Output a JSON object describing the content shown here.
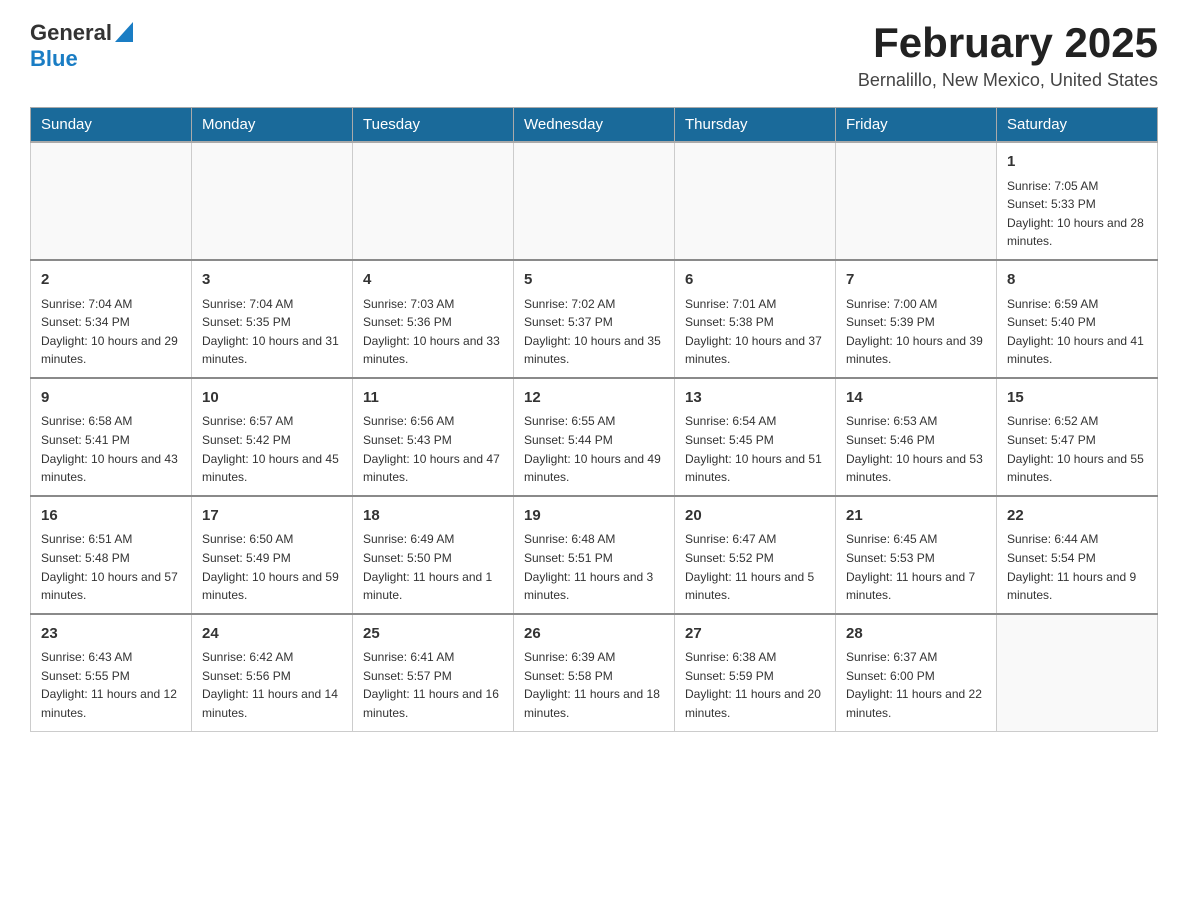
{
  "header": {
    "logo_general": "General",
    "logo_blue": "Blue",
    "month_title": "February 2025",
    "location": "Bernalillo, New Mexico, United States"
  },
  "calendar": {
    "days_of_week": [
      "Sunday",
      "Monday",
      "Tuesday",
      "Wednesday",
      "Thursday",
      "Friday",
      "Saturday"
    ],
    "weeks": [
      [
        {
          "day": "",
          "info": ""
        },
        {
          "day": "",
          "info": ""
        },
        {
          "day": "",
          "info": ""
        },
        {
          "day": "",
          "info": ""
        },
        {
          "day": "",
          "info": ""
        },
        {
          "day": "",
          "info": ""
        },
        {
          "day": "1",
          "info": "Sunrise: 7:05 AM\nSunset: 5:33 PM\nDaylight: 10 hours and 28 minutes."
        }
      ],
      [
        {
          "day": "2",
          "info": "Sunrise: 7:04 AM\nSunset: 5:34 PM\nDaylight: 10 hours and 29 minutes."
        },
        {
          "day": "3",
          "info": "Sunrise: 7:04 AM\nSunset: 5:35 PM\nDaylight: 10 hours and 31 minutes."
        },
        {
          "day": "4",
          "info": "Sunrise: 7:03 AM\nSunset: 5:36 PM\nDaylight: 10 hours and 33 minutes."
        },
        {
          "day": "5",
          "info": "Sunrise: 7:02 AM\nSunset: 5:37 PM\nDaylight: 10 hours and 35 minutes."
        },
        {
          "day": "6",
          "info": "Sunrise: 7:01 AM\nSunset: 5:38 PM\nDaylight: 10 hours and 37 minutes."
        },
        {
          "day": "7",
          "info": "Sunrise: 7:00 AM\nSunset: 5:39 PM\nDaylight: 10 hours and 39 minutes."
        },
        {
          "day": "8",
          "info": "Sunrise: 6:59 AM\nSunset: 5:40 PM\nDaylight: 10 hours and 41 minutes."
        }
      ],
      [
        {
          "day": "9",
          "info": "Sunrise: 6:58 AM\nSunset: 5:41 PM\nDaylight: 10 hours and 43 minutes."
        },
        {
          "day": "10",
          "info": "Sunrise: 6:57 AM\nSunset: 5:42 PM\nDaylight: 10 hours and 45 minutes."
        },
        {
          "day": "11",
          "info": "Sunrise: 6:56 AM\nSunset: 5:43 PM\nDaylight: 10 hours and 47 minutes."
        },
        {
          "day": "12",
          "info": "Sunrise: 6:55 AM\nSunset: 5:44 PM\nDaylight: 10 hours and 49 minutes."
        },
        {
          "day": "13",
          "info": "Sunrise: 6:54 AM\nSunset: 5:45 PM\nDaylight: 10 hours and 51 minutes."
        },
        {
          "day": "14",
          "info": "Sunrise: 6:53 AM\nSunset: 5:46 PM\nDaylight: 10 hours and 53 minutes."
        },
        {
          "day": "15",
          "info": "Sunrise: 6:52 AM\nSunset: 5:47 PM\nDaylight: 10 hours and 55 minutes."
        }
      ],
      [
        {
          "day": "16",
          "info": "Sunrise: 6:51 AM\nSunset: 5:48 PM\nDaylight: 10 hours and 57 minutes."
        },
        {
          "day": "17",
          "info": "Sunrise: 6:50 AM\nSunset: 5:49 PM\nDaylight: 10 hours and 59 minutes."
        },
        {
          "day": "18",
          "info": "Sunrise: 6:49 AM\nSunset: 5:50 PM\nDaylight: 11 hours and 1 minute."
        },
        {
          "day": "19",
          "info": "Sunrise: 6:48 AM\nSunset: 5:51 PM\nDaylight: 11 hours and 3 minutes."
        },
        {
          "day": "20",
          "info": "Sunrise: 6:47 AM\nSunset: 5:52 PM\nDaylight: 11 hours and 5 minutes."
        },
        {
          "day": "21",
          "info": "Sunrise: 6:45 AM\nSunset: 5:53 PM\nDaylight: 11 hours and 7 minutes."
        },
        {
          "day": "22",
          "info": "Sunrise: 6:44 AM\nSunset: 5:54 PM\nDaylight: 11 hours and 9 minutes."
        }
      ],
      [
        {
          "day": "23",
          "info": "Sunrise: 6:43 AM\nSunset: 5:55 PM\nDaylight: 11 hours and 12 minutes."
        },
        {
          "day": "24",
          "info": "Sunrise: 6:42 AM\nSunset: 5:56 PM\nDaylight: 11 hours and 14 minutes."
        },
        {
          "day": "25",
          "info": "Sunrise: 6:41 AM\nSunset: 5:57 PM\nDaylight: 11 hours and 16 minutes."
        },
        {
          "day": "26",
          "info": "Sunrise: 6:39 AM\nSunset: 5:58 PM\nDaylight: 11 hours and 18 minutes."
        },
        {
          "day": "27",
          "info": "Sunrise: 6:38 AM\nSunset: 5:59 PM\nDaylight: 11 hours and 20 minutes."
        },
        {
          "day": "28",
          "info": "Sunrise: 6:37 AM\nSunset: 6:00 PM\nDaylight: 11 hours and 22 minutes."
        },
        {
          "day": "",
          "info": ""
        }
      ]
    ]
  }
}
